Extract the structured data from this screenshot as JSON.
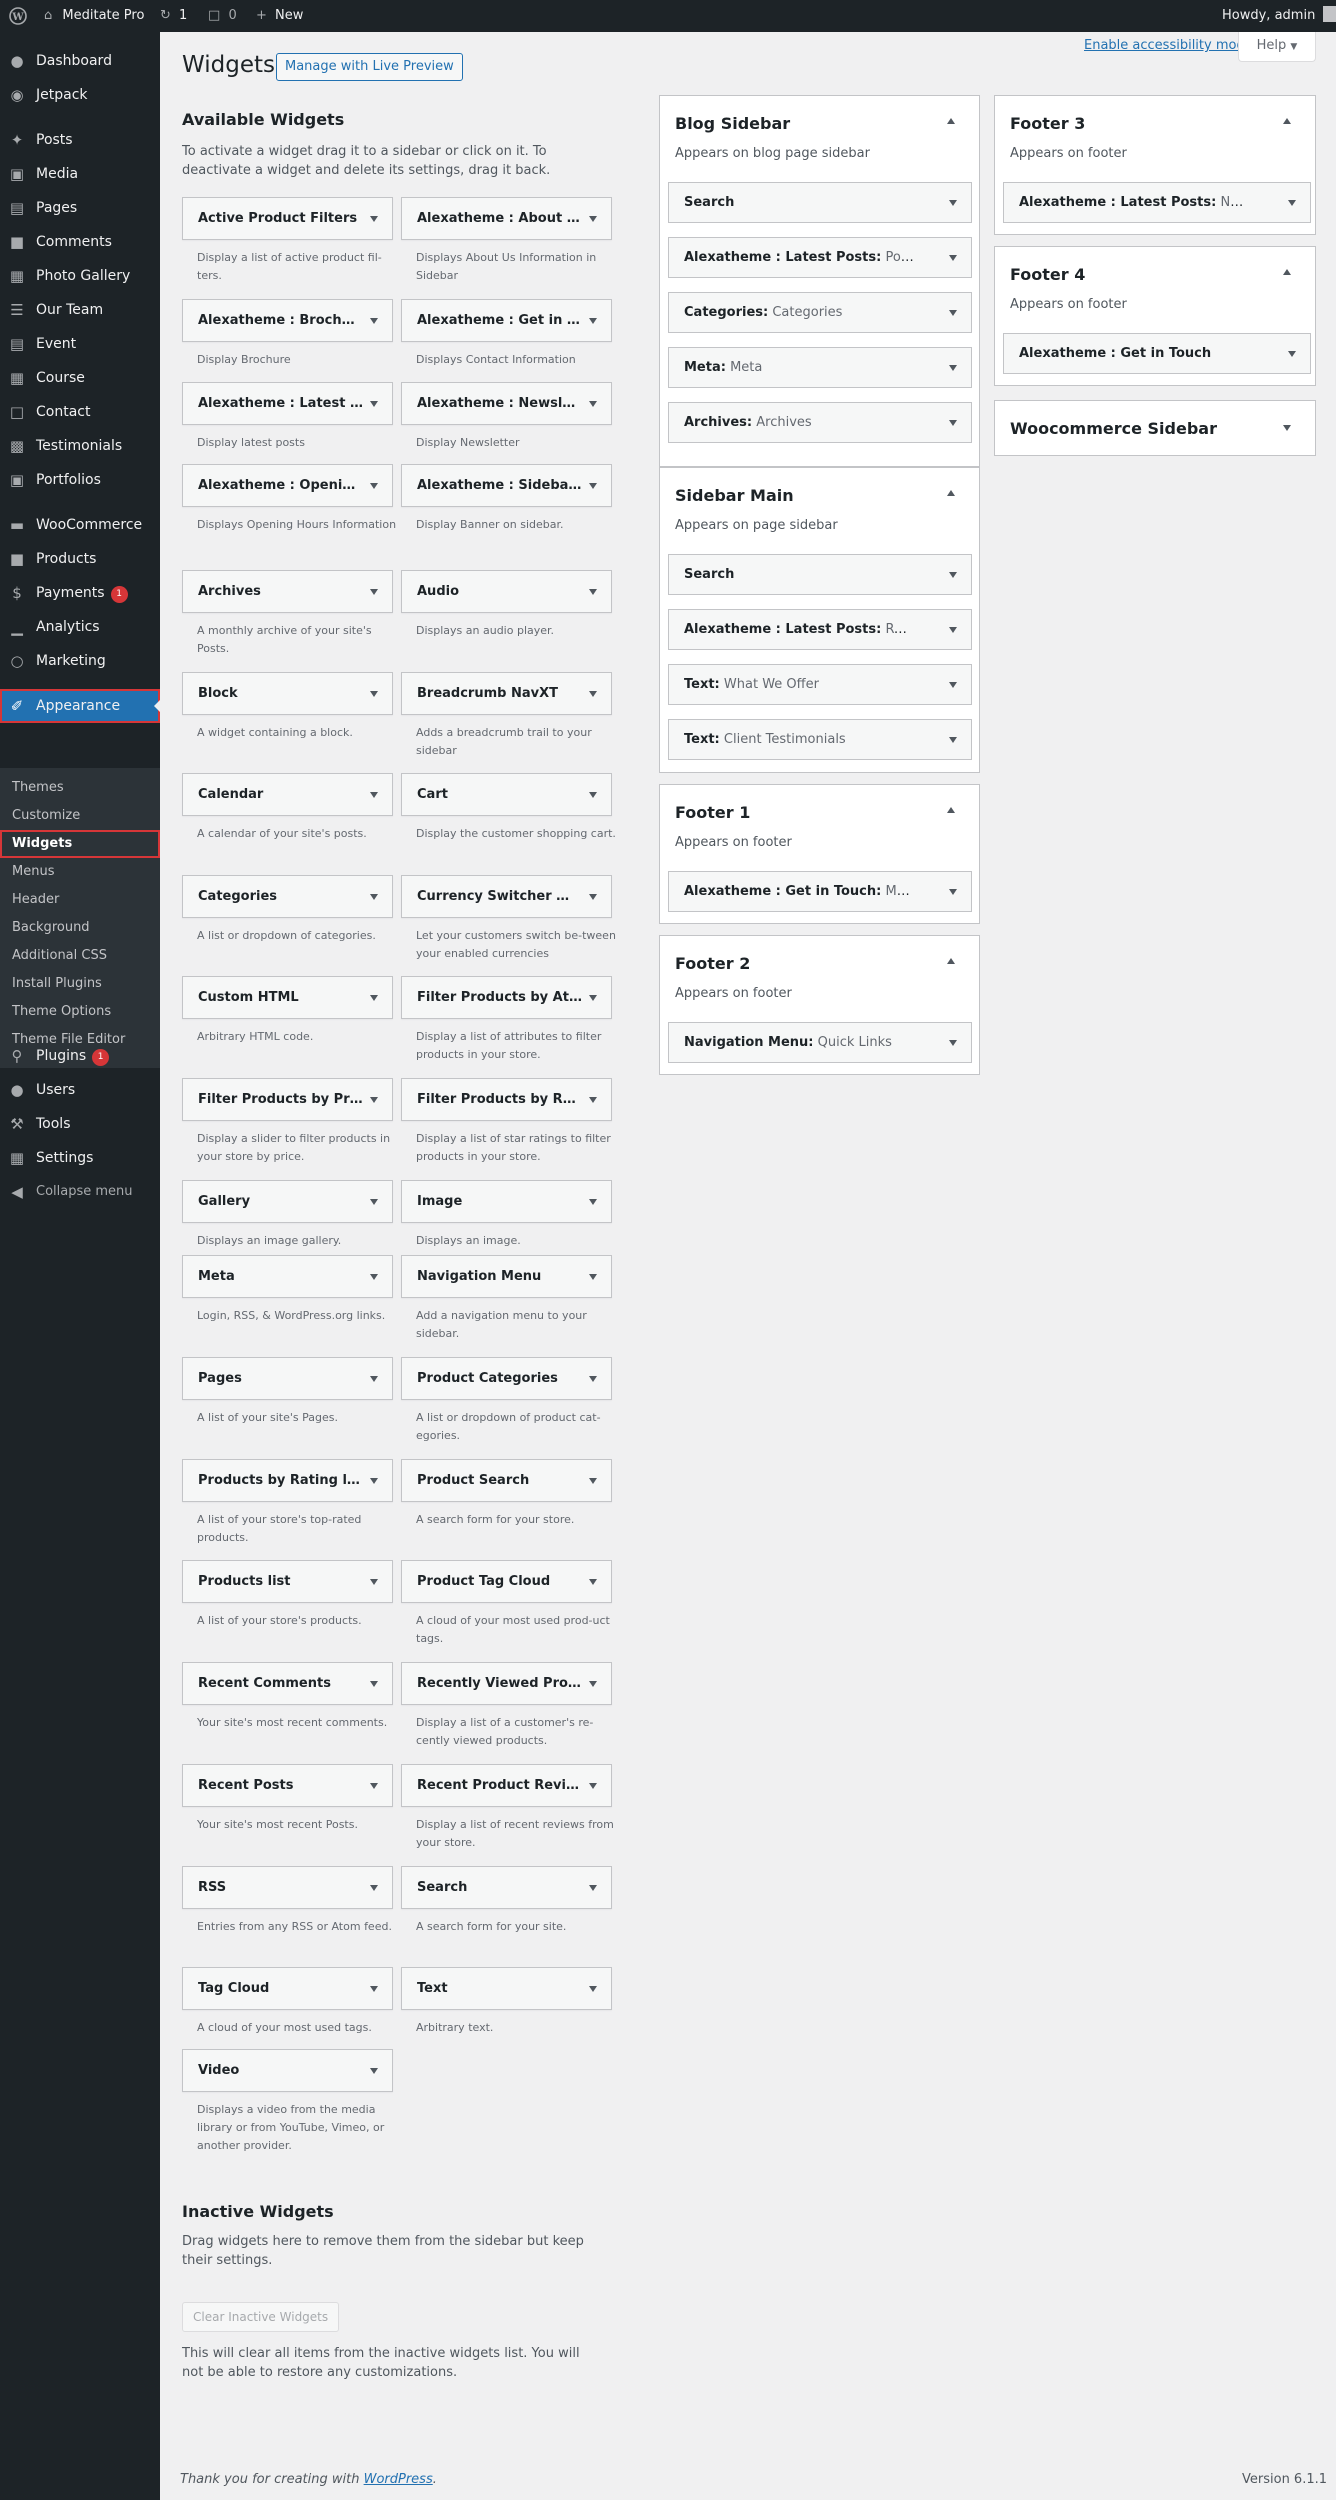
{
  "admin_bar": {
    "site_name": "Meditate Pro",
    "updates_count": "1",
    "comments_count": "0",
    "new_label": "New",
    "greeting": "Howdy, admin"
  },
  "menu": {
    "dashboard": "Dashboard",
    "jetpack": "Jetpack",
    "posts": "Posts",
    "media": "Media",
    "pages": "Pages",
    "comments": "Comments",
    "photo_gallery": "Photo Gallery",
    "our_team": "Our Team",
    "event": "Event",
    "course": "Course",
    "contact": "Contact",
    "testimonials": "Testimonials",
    "portfolios": "Portfolios",
    "woocommerce": "WooCommerce",
    "products": "Products",
    "payments": "Payments",
    "payments_badge": "1",
    "analytics": "Analytics",
    "marketing": "Marketing",
    "appearance": "Appearance",
    "plugins": "Plugins",
    "plugins_badge": "1",
    "users": "Users",
    "tools": "Tools",
    "settings": "Settings",
    "collapse": "Collapse menu"
  },
  "submenu": {
    "themes": "Themes",
    "customize": "Customize",
    "widgets": "Widgets",
    "menus": "Menus",
    "header": "Header",
    "background": "Background",
    "additional_css": "Additional CSS",
    "install_plugins": "Install Plugins",
    "theme_options": "Theme Options",
    "theme_file_editor": "Theme File Editor"
  },
  "page": {
    "title": "Widgets",
    "live_preview": "Manage with Live Preview",
    "accessibility_link": "Enable accessibility mode",
    "help": "Help"
  },
  "available": {
    "heading": "Available Widgets",
    "description": "To activate a widget drag it to a sidebar or click on it. To deactivate a widget and delete its settings, drag it back.",
    "widgets": [
      {
        "title": "Active Product Filters",
        "desc": "Display a list of active product fil-ters."
      },
      {
        "title": "Alexatheme : About Us",
        "desc": "Displays About Us Information in Sidebar"
      },
      {
        "title": "Alexatheme : Brochure",
        "desc": "Display Brochure"
      },
      {
        "title": "Alexatheme : Get in Touch",
        "desc": "Displays Contact Information"
      },
      {
        "title": "Alexatheme : Latest Posts",
        "desc": "Display latest posts"
      },
      {
        "title": "Alexatheme : Newsletter",
        "desc": "Display Newsletter"
      },
      {
        "title": "Alexatheme : Opening Hours",
        "desc": "Displays Opening Hours Information"
      },
      {
        "title": "Alexatheme : Sidebar Banner",
        "desc": "Display Banner on sidebar."
      },
      {
        "title": "Archives",
        "desc": "A monthly archive of your site's Posts."
      },
      {
        "title": "Audio",
        "desc": "Displays an audio player."
      },
      {
        "title": "Block",
        "desc": "A widget containing a block."
      },
      {
        "title": "Breadcrumb NavXT",
        "desc": "Adds a breadcrumb trail to your sidebar"
      },
      {
        "title": "Calendar",
        "desc": "A calendar of your site's posts."
      },
      {
        "title": "Cart",
        "desc": "Display the customer shopping cart."
      },
      {
        "title": "Categories",
        "desc": "A list or dropdown of categories."
      },
      {
        "title": "Currency Switcher Widget",
        "desc": "Let your customers switch be-tween your enabled currencies"
      },
      {
        "title": "Custom HTML",
        "desc": "Arbitrary HTML code."
      },
      {
        "title": "Filter Products by Attribute",
        "desc": "Display a list of attributes to filter products in your store."
      },
      {
        "title": "Filter Products by Price",
        "desc": "Display a slider to filter products in your store by price."
      },
      {
        "title": "Filter Products by Rating",
        "desc": "Display a list of star ratings to filter products in your store."
      },
      {
        "title": "Gallery",
        "desc": "Displays an image gallery."
      },
      {
        "title": "Image",
        "desc": "Displays an image."
      },
      {
        "title": "Meta",
        "desc": "Login, RSS, & WordPress.org links."
      },
      {
        "title": "Navigation Menu",
        "desc": "Add a navigation menu to your sidebar."
      },
      {
        "title": "Pages",
        "desc": "A list of your site's Pages."
      },
      {
        "title": "Product Categories",
        "desc": "A list or dropdown of product cat-egories."
      },
      {
        "title": "Products by Rating list",
        "desc": "A list of your store's top-rated products."
      },
      {
        "title": "Product Search",
        "desc": "A search form for your store."
      },
      {
        "title": "Products list",
        "desc": "A list of your store's products."
      },
      {
        "title": "Product Tag Cloud",
        "desc": "A cloud of your most used prod-uct tags."
      },
      {
        "title": "Recent Comments",
        "desc": "Your site's most recent comments."
      },
      {
        "title": "Recently Viewed Products",
        "desc": "Display a list of a customer's re-cently viewed products."
      },
      {
        "title": "Recent Posts",
        "desc": "Your site's most recent Posts."
      },
      {
        "title": "Recent Product Reviews",
        "desc": "Display a list of recent reviews from your store."
      },
      {
        "title": "RSS",
        "desc": "Entries from any RSS or Atom feed."
      },
      {
        "title": "Search",
        "desc": "A search form for your site."
      },
      {
        "title": "Tag Cloud",
        "desc": "A cloud of your most used tags."
      },
      {
        "title": "Text",
        "desc": "Arbitrary text."
      },
      {
        "title": "Video",
        "desc": "Displays a video from the media library or from YouTube, Vimeo, or another provider."
      }
    ]
  },
  "areas": {
    "blog": {
      "title": "Blog Sidebar",
      "desc": "Appears on blog page sidebar",
      "widgets": [
        {
          "name": "Search",
          "sub": ""
        },
        {
          "name": "Alexatheme : Latest Posts:",
          "sub": "Popular Posts"
        },
        {
          "name": "Categories:",
          "sub": "Categories"
        },
        {
          "name": "Meta:",
          "sub": "Meta"
        },
        {
          "name": "Archives:",
          "sub": "Archives"
        }
      ]
    },
    "main": {
      "title": "Sidebar Main",
      "desc": "Appears on page sidebar",
      "widgets": [
        {
          "name": "Search",
          "sub": ""
        },
        {
          "name": "Alexatheme : Latest Posts:",
          "sub": "Recent Posts"
        },
        {
          "name": "Text:",
          "sub": "What We Offer"
        },
        {
          "name": "Text:",
          "sub": "Client Testimonials"
        }
      ]
    },
    "footer1": {
      "title": "Footer 1",
      "desc": "Appears on footer",
      "widgets": [
        {
          "name": "Alexatheme : Get in Touch:",
          "sub": "Meditate Pro"
        }
      ]
    },
    "footer2": {
      "title": "Footer 2",
      "desc": "Appears on footer",
      "widgets": [
        {
          "name": "Navigation Menu:",
          "sub": "Quick Links"
        }
      ]
    },
    "footer3": {
      "title": "Footer 3",
      "desc": "Appears on footer",
      "widgets": [
        {
          "name": "Alexatheme : Latest Posts:",
          "sub": "News Update"
        }
      ]
    },
    "footer4": {
      "title": "Footer 4",
      "desc": "Appears on footer",
      "widgets": [
        {
          "name": "Alexatheme : Get in Touch",
          "sub": ""
        }
      ]
    },
    "woo": {
      "title": "Woocommerce Sidebar"
    }
  },
  "inactive": {
    "heading": "Inactive Widgets",
    "description": "Drag widgets here to remove them from the sidebar but keep their settings.",
    "clear_button": "Clear Inactive Widgets",
    "note": "This will clear all items from the inactive widgets list. You will not be able to restore any customizations."
  },
  "footer": {
    "thanks": "Thank you for creating with",
    "link": "WordPress",
    "period": ".",
    "version": "Version 6.1.1"
  },
  "colors": {
    "accent": "#2271b1",
    "admin_dark": "#1d2327",
    "badge": "#d63638",
    "highlight_outline": "#d63638"
  }
}
